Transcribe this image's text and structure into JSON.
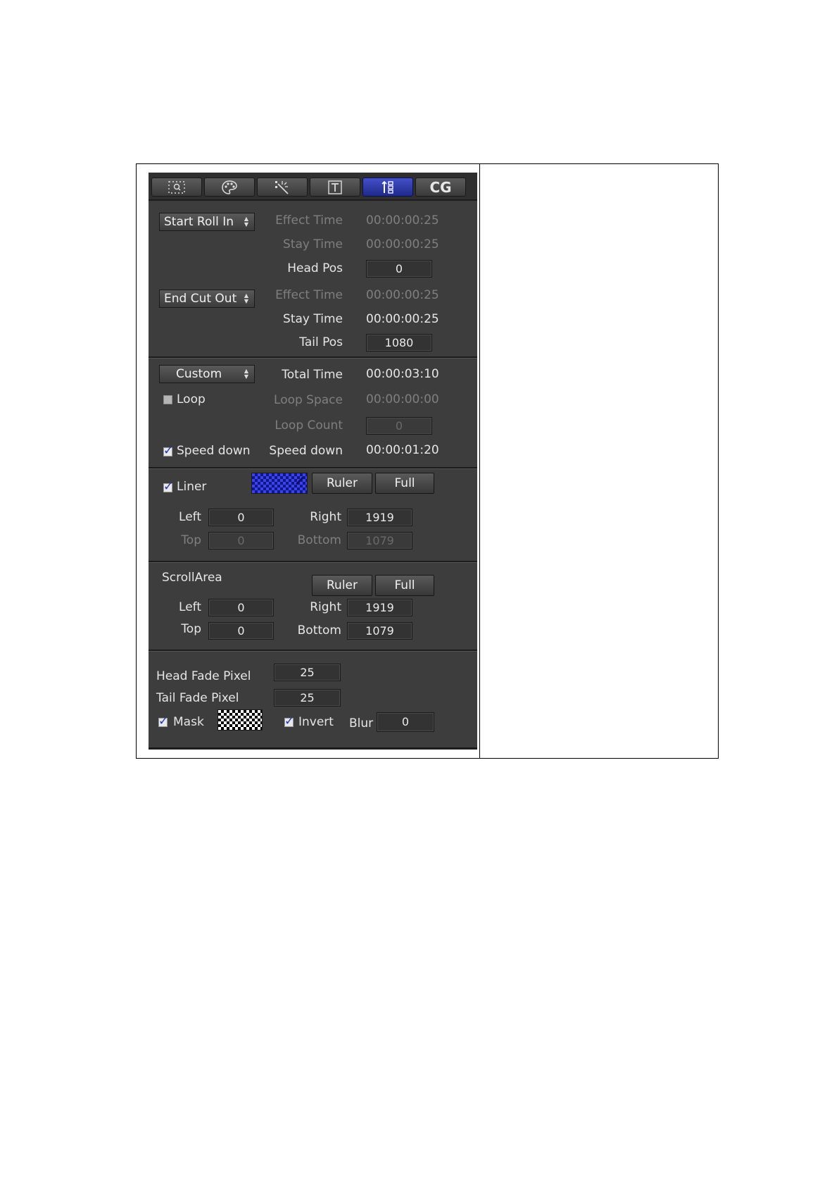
{
  "tabs": [
    {
      "icon": "position-icon",
      "active": false
    },
    {
      "icon": "palette-icon",
      "active": false
    },
    {
      "icon": "effect-wand-icon",
      "active": false
    },
    {
      "icon": "text-icon",
      "active": false
    },
    {
      "icon": "roll-list-icon",
      "active": true
    },
    {
      "label": "CG",
      "active": false
    }
  ],
  "roll_in": {
    "mode": "Start Roll In",
    "effect_time_label": "Effect Time",
    "effect_time": "00:00:00:25",
    "stay_time_label": "Stay Time",
    "stay_time": "00:00:00:25",
    "head_pos_label": "Head Pos",
    "head_pos": "0"
  },
  "roll_out": {
    "mode": "End Cut Out",
    "effect_time_label": "Effect Time",
    "effect_time": "00:00:00:25",
    "stay_time_label": "Stay Time",
    "stay_time": "00:00:00:25",
    "tail_pos_label": "Tail Pos",
    "tail_pos": "1080"
  },
  "timing": {
    "mode": "Custom",
    "total_time_label": "Total Time",
    "total_time": "00:00:03:10",
    "loop_label": "Loop",
    "loop_checked": false,
    "loop_space_label": "Loop Space",
    "loop_space": "00:00:00:00",
    "loop_count_label": "Loop Count",
    "loop_count": "0",
    "speed_down_check_label": "Speed down",
    "speed_down_checked": true,
    "speed_down_label": "Speed down",
    "speed_down": "00:00:01:20"
  },
  "liner": {
    "label": "Liner",
    "checked": true,
    "ruler_label": "Ruler",
    "full_label": "Full",
    "left_label": "Left",
    "left": "0",
    "right_label": "Right",
    "right": "1919",
    "top_label": "Top",
    "top": "0",
    "bottom_label": "Bottom",
    "bottom": "1079"
  },
  "scroll_area": {
    "label": "ScrollArea",
    "ruler_label": "Ruler",
    "full_label": "Full",
    "left_label": "Left",
    "left": "0",
    "right_label": "Right",
    "right": "1919",
    "top_label": "Top",
    "top": "0",
    "bottom_label": "Bottom",
    "bottom": "1079"
  },
  "fade": {
    "head_label": "Head Fade Pixel",
    "head": "25",
    "tail_label": "Tail Fade Pixel",
    "tail": "25",
    "mask_label": "Mask",
    "mask_checked": true,
    "invert_label": "Invert",
    "invert_checked": true,
    "blur_label": "Blur",
    "blur": "0"
  },
  "colors": {
    "panel_bg": "#3d3d3d",
    "active_tab": "#2d39b0",
    "liner_swatch": "#3b43e6",
    "check_tick": "#1f35c0"
  }
}
